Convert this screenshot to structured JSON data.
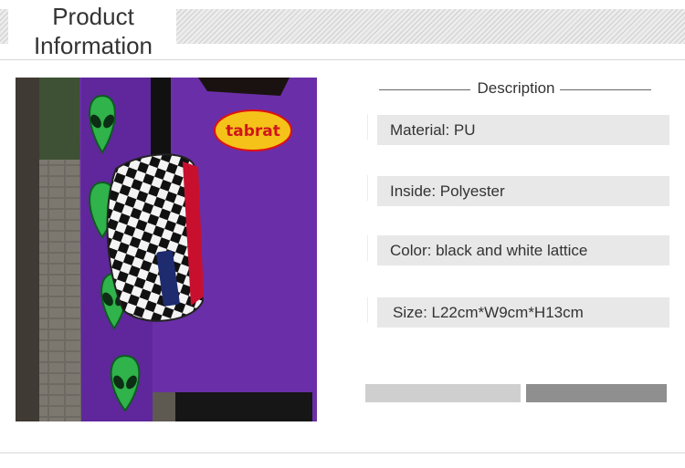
{
  "header": {
    "title_line1": "Product",
    "title_line2": "Information"
  },
  "description": {
    "heading": "Description",
    "items": [
      "Material: PU",
      "Inside: Polyester",
      "Color: black and white lattice",
      "Size: L22cm*W9cm*H13cm"
    ]
  },
  "photo": {
    "patch_text": "tabrat",
    "colors": {
      "sweater": "#6a2fa8",
      "alien": "#2fb34a",
      "patch": "#f5c21a"
    }
  }
}
